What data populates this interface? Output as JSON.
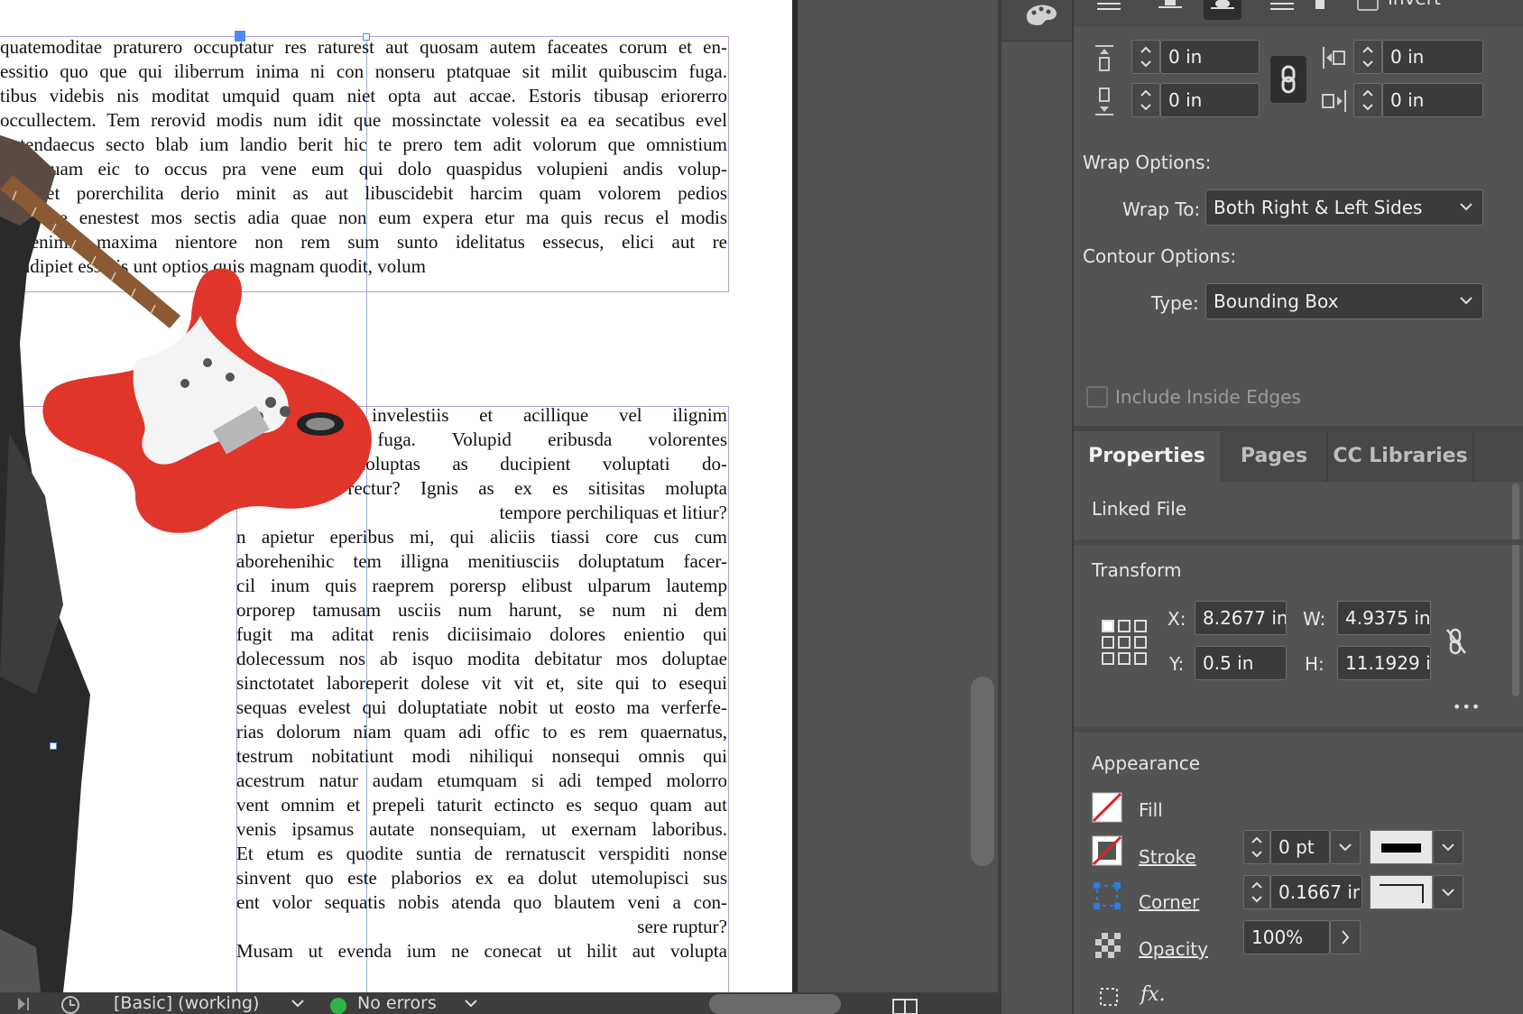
{
  "document": {
    "text_top_lines": [
      "quatemoditae praturero occuptatur res raturest aut quosam autem faceates corum et en-",
      "essitio quo que qui iliberrum inima ni con nonseru ptatquae sit milit quibuscim fuga.",
      "tibus videbis nis moditat umquid quam niet opta aut accae. Estoris tibusap eriorerro",
      "occullectem. Tem rerovid modis num idit que mossinctate volessit ea ea secatibus evel",
      "tintendaecus secto blab ium landio berit hic te prero tem adit volorum que omnistium",
      "Em quam eic to occus pra vene eum qui dolo quaspidus volupieni andis volup-",
      "olut et porerchilita derio minit as aut libuscidebit harcim quam volorem pedios",
      "o ea pe enestest mos sectis adia quae non eum expera etur ma quis recus el modis",
      "sapienimil maxima nientore non rem sum sunto idelitatus essecus, elici aut re",
      "se ndipiet essinis unt optios quis magnam quodit, volum"
    ],
    "text_bottom_lines": [
      "nobit aspit invelestiis et acillique vel ilignim",
      "nim inum fuga. Volupid eribusda volorentes",
      "rum eos doluptas as ducipient voluptati do-",
      ", et eum rectur? Ignis as ex es sitisitas molupta",
      "tempore perchiliquas et litiur?",
      "n apietur eperibus mi, qui aliciis tiassi core cus cum",
      "aborehenihic tem illigna menitiusciis doluptatum facer-",
      "cil inum quis raeprem porersp elibust ulparum lautemp",
      "orporep tamusam usciis num harunt, se num ni dem",
      "fugit ma aditat renis diciisimaio dolores enientio qui",
      "dolecessum nos ab isquo modita debitatur mos doluptae",
      "sinctotatet laboreperit dolese vit vit et, site qui to esequi",
      "sequas evelest qui doluptatiate nobit ut eosto ma verferfe-",
      "rias dolorum niam quam adi offic to es rem quaernatus,",
      "testrum nobitatiunt modi nihiliqui nonsequi omnis qui",
      "acestrum natur audam etumquam si adi temped molorro",
      "vent omnim et prepeli taturit ectincto es sequo quam aut",
      "venis ipsamus autate nonsequiam, ut exernam laboribus.",
      "Et etum es quodite suntia de rernatuscit verspiditi nonse",
      "sinvent quo este plaborios ex ea dolut utemolupisci sus",
      "ent volor sequatis nobis atenda quo blautem veni a con-",
      "sere ruptur?",
      "Musam ut evenda ium ne conecat ut hilit aut volupta"
    ],
    "bottom_align": [
      "j",
      "j",
      "j",
      "j",
      "r",
      "j",
      "j",
      "j",
      "j",
      "j",
      "j",
      "j",
      "j",
      "j",
      "j",
      "j",
      "j",
      "j",
      "j",
      "j",
      "j",
      "r",
      "j"
    ]
  },
  "wrap_panel": {
    "top_label": "Invert",
    "offset_top": "0 in",
    "offset_bottom": "0 in",
    "offset_left": "0 in",
    "offset_right": "0 in",
    "wrap_options_heading": "Wrap Options:",
    "wrap_to_label": "Wrap To:",
    "wrap_to_value": "Both Right & Left Sides",
    "contour_options_heading": "Contour Options:",
    "type_label": "Type:",
    "type_value": "Bounding Box",
    "include_inside_edges": "Include Inside Edges"
  },
  "tabs": [
    {
      "label": "Properties",
      "active": true
    },
    {
      "label": "Pages",
      "active": false
    },
    {
      "label": "CC Libraries",
      "active": false
    }
  ],
  "properties": {
    "linked_file": "Linked File",
    "transform_heading": "Transform",
    "x_label": "X:",
    "x_value": "8.2677 in",
    "y_label": "Y:",
    "y_value": "0.5 in",
    "w_label": "W:",
    "w_value": "4.9375 in",
    "h_label": "H:",
    "h_value": "11.1929 i",
    "more": "•••",
    "appearance_heading": "Appearance",
    "fill_label": "Fill",
    "stroke_label": "Stroke",
    "stroke_value": "0 pt",
    "corner_label": "Corner",
    "corner_value": "0.1667 ir",
    "opacity_label": "Opacity",
    "opacity_value": "100%",
    "fx_label": "fx."
  },
  "statusbar": {
    "style": "[Basic] (working)",
    "errors": "No errors"
  },
  "colors": {
    "panel_bg": "#535353",
    "field_bg": "#3b3b3b",
    "selection_blue": "#4a8cf7",
    "preflight_green": "#2fb34a",
    "guitar_red": "#e0352b"
  }
}
